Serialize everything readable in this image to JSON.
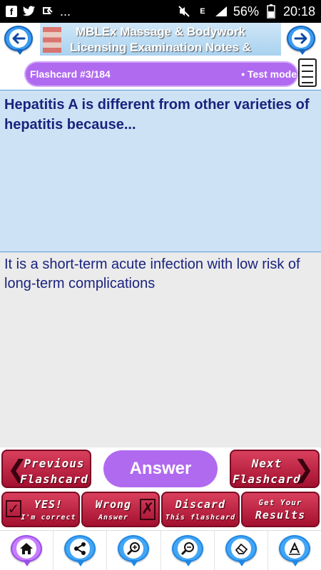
{
  "status_bar": {
    "left_icons": [
      "facebook-icon",
      "twitter-icon",
      "notification-icon"
    ],
    "overflow": "...",
    "battery_percent": "56%",
    "time": "20:18"
  },
  "header": {
    "back_icon": "arrow-left-icon",
    "forward_icon": "arrow-right-icon",
    "banner_title_line1": "MBLEx Massage & Bodywork",
    "banner_title_line2": "Licensing Examination Notes &"
  },
  "card_bar": {
    "counter": "Flashcard #3/184",
    "mode": "• Test mode"
  },
  "card": {
    "question": "Hepatitis A is different from other varieties of hepatitis because...",
    "answer": "It is a short-term acute infection with low risk of long-term complications"
  },
  "nav_buttons": {
    "previous_line1": "Previous",
    "previous_line2": "Flashcard",
    "answer": "Answer",
    "next_line1": "Next",
    "next_line2": "Flashcard"
  },
  "action_buttons": {
    "yes_line1": "YES!",
    "yes_line2": "I'm correct",
    "wrong_line1": "Wrong",
    "wrong_line2": "Answer",
    "discard_line1": "Discard",
    "discard_line2": "This flashcard",
    "results_line1": "Get Your",
    "results_line2": "Results"
  },
  "toolbar": {
    "items": [
      "home-icon",
      "share-icon",
      "zoom-in-icon",
      "zoom-out-icon",
      "eraser-icon",
      "font-icon"
    ]
  },
  "colors": {
    "accent_purple": "#b06af0",
    "button_red": "#c2274a",
    "question_bg": "#cde3f5",
    "text_navy": "#1a237e",
    "pin_blue": "#42a5f5"
  }
}
